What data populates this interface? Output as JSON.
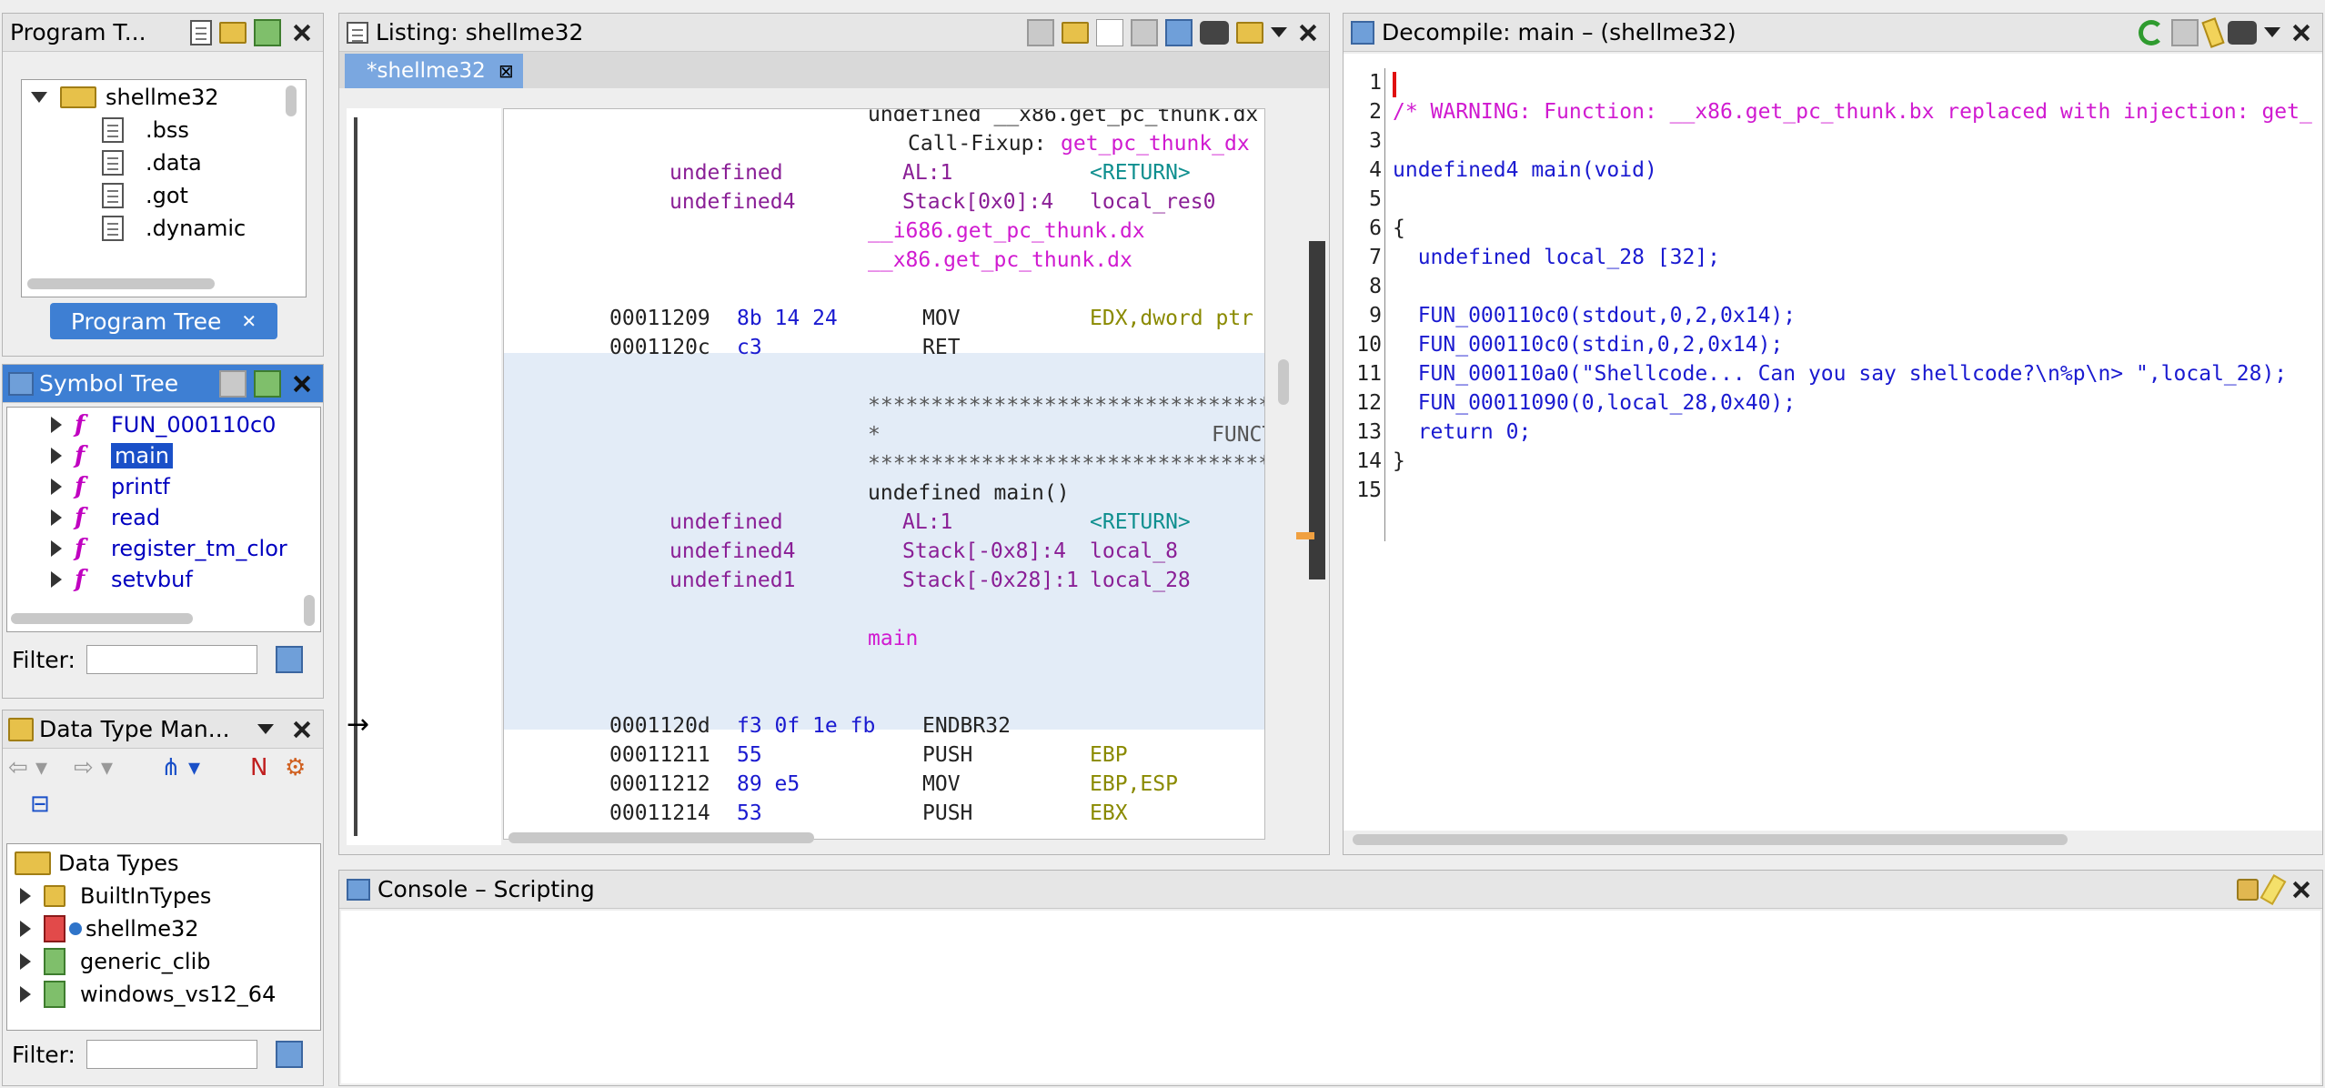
{
  "program_tree": {
    "title": "Program T...",
    "root": "shellme32",
    "items": [
      ".bss",
      ".data",
      ".got",
      ".dynamic"
    ],
    "tab_label": "Program Tree"
  },
  "symbol_tree": {
    "title": "Symbol Tree",
    "items": [
      "FUN_000110c0",
      "main",
      "printf",
      "read",
      "register_tm_clor",
      "setvbuf"
    ],
    "filter_label": "Filter:"
  },
  "data_type_manager": {
    "title": "Data Type Man...",
    "root": "Data Types",
    "items": [
      "BuiltInTypes",
      "shellme32",
      "generic_clib",
      "windows_vs12_64"
    ],
    "filter_label": "Filter:"
  },
  "listing": {
    "title": "Listing:  shellme32",
    "tab": "*shellme32",
    "lines": [
      {
        "addr": "",
        "bytes": "",
        "col1": "undefined __x86.get_pc_thunk.dx",
        "kind": "hdr"
      },
      {
        "addr": "",
        "bytes": "",
        "col1": "Call-Fixup:",
        "col2": "get_pc_thunk_dx",
        "kind": "fixup"
      },
      {
        "type": "undefined",
        "loc": "AL:1",
        "name": "<RETURN>",
        "kind": "var"
      },
      {
        "type": "undefined4",
        "loc": "Stack[0x0]:4",
        "name": "local_res0",
        "kind": "var"
      },
      {
        "label": "__i686.get_pc_thunk.dx",
        "kind": "label"
      },
      {
        "label": "__x86.get_pc_thunk.dx",
        "kind": "label"
      },
      {
        "kind": "blank"
      },
      {
        "addr": "00011209",
        "bytes": "8b 14 24",
        "mnem": "MOV",
        "ops": "EDX,dword ptr [E",
        "kind": "code"
      },
      {
        "addr": "0001120c",
        "bytes": "c3",
        "mnem": "RET",
        "ops": "",
        "kind": "code"
      },
      {
        "kind": "blank"
      },
      {
        "stars": "************************************",
        "kind": "stars"
      },
      {
        "stars": "*",
        "funct": "FUNCT",
        "kind": "starmid"
      },
      {
        "stars": "************************************",
        "kind": "stars"
      },
      {
        "sig": "undefined main()",
        "kind": "sig"
      },
      {
        "type": "undefined",
        "loc": "AL:1",
        "name": "<RETURN>",
        "kind": "var"
      },
      {
        "type": "undefined4",
        "loc": "Stack[-0x8]:4",
        "name": "local_8",
        "kind": "var"
      },
      {
        "type": "undefined1",
        "loc": "Stack[-0x28]:1",
        "name": "local_28",
        "kind": "var"
      },
      {
        "kind": "blank"
      },
      {
        "label": "main",
        "kind": "label"
      },
      {
        "kind": "blank"
      },
      {
        "kind": "blank"
      },
      {
        "addr": "0001120d",
        "bytes": "f3 0f 1e fb",
        "mnem": "ENDBR32",
        "ops": "",
        "kind": "code"
      },
      {
        "addr": "00011211",
        "bytes": "55",
        "mnem": "PUSH",
        "ops": "EBP",
        "kind": "code"
      },
      {
        "addr": "00011212",
        "bytes": "89 e5",
        "mnem": "MOV",
        "ops": "EBP,ESP",
        "kind": "code"
      },
      {
        "addr": "00011214",
        "bytes": "53",
        "mnem": "PUSH",
        "ops": "EBX",
        "kind": "code"
      }
    ]
  },
  "decompile": {
    "title": "Decompile: main –  (shellme32)",
    "lines": [
      "",
      "/* WARNING: Function: __x86.get_pc_thunk.bx replaced with injection: get_",
      "",
      "undefined4 main(void)",
      "",
      "{",
      "  undefined local_28 [32];",
      "",
      "  FUN_000110c0(stdout,0,2,0x14);",
      "  FUN_000110c0(stdin,0,2,0x14);",
      "  FUN_000110a0(\"Shellcode... Can you say shellcode?\\n%p\\n> \",local_28);",
      "  FUN_00011090(0,local_28,0x40);",
      "  return 0;",
      "}",
      ""
    ]
  },
  "console": {
    "title": "Console – Scripting"
  },
  "colors": {
    "accent": "#3e7fd3",
    "selection": "#1a50c8",
    "function_hl": "#e3ecf7"
  }
}
